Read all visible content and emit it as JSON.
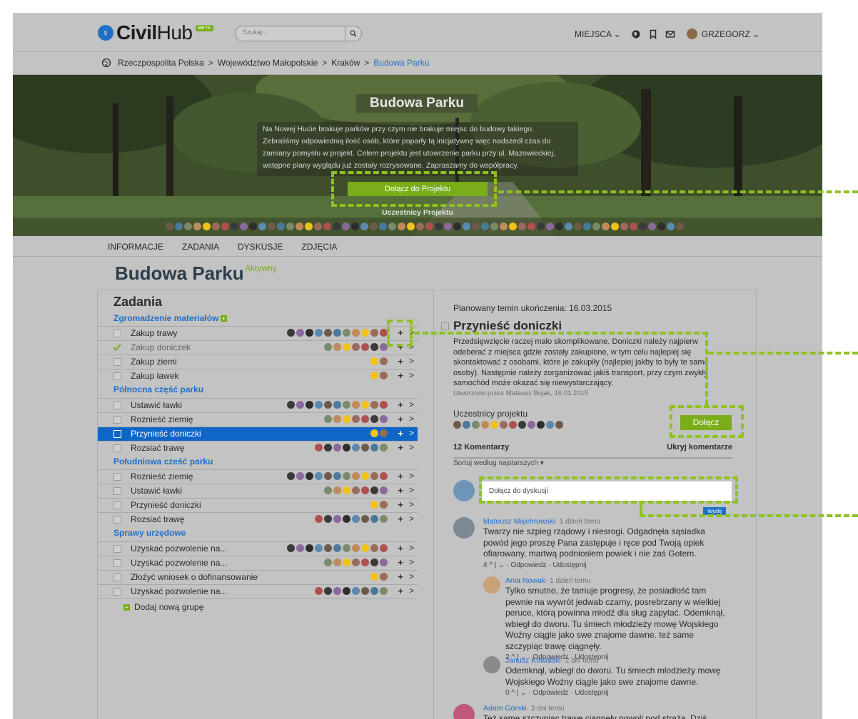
{
  "header": {
    "logo_civil": "Civil",
    "logo_hub": "Hub",
    "beta": "BETA",
    "search_placeholder": "Szukaj...",
    "places_menu": "MIEJSCA ⌄",
    "user_menu": "GRZEGORZ ⌄"
  },
  "breadcrumb": {
    "items": [
      "Rzeczpospolita Polska",
      "Województwo Małopolskie",
      "Kraków"
    ],
    "separator": ">",
    "current": "Budowa Parku"
  },
  "hero": {
    "title": "Budowa Parku",
    "description": "Na Nowej Hucie brakuje parków przy czym nie brakuje miejsc do budowy takiego. Zebraliśmy odpowiednią ilość osób, które poparły tą inicjatywnę więc nadszedł czas do zamiany pomysłu w projekt. Celem projektu jest utowrzenie parku przy ul. Mazowieckiej, wstępne plany wyglądu już zostały rozrysowane. Zapraszamy do współpracy.",
    "join_button": "Dołącz do Projektu",
    "participants_label": "Uczestnicy Projektu"
  },
  "tabs": [
    "INFORMACJE",
    "ZADANIA",
    "DYSKUSJE",
    "ZDJĘCIA"
  ],
  "project": {
    "title": "Budowa Parku",
    "status": "Aktywny"
  },
  "tasks": {
    "title": "Zadania",
    "add_group": "Dodaj nową grupę",
    "groups": [
      {
        "name": "Zgromadzenie materiałów",
        "items": [
          {
            "name": "Zakup trawy"
          },
          {
            "name": "Zakup doniczek"
          },
          {
            "name": "Zakup ziemi"
          },
          {
            "name": "Zakup ławek"
          }
        ]
      },
      {
        "name": "Północna część parku",
        "items": [
          {
            "name": "Ustawić ławki"
          },
          {
            "name": "Roznieść ziemię"
          },
          {
            "name": "Przynieść doniczki"
          },
          {
            "name": "Rozsiać trawę"
          }
        ]
      },
      {
        "name": "Południowa cześć parku",
        "items": [
          {
            "name": "Roznieść ziemię"
          },
          {
            "name": "Ustawić ławki"
          },
          {
            "name": "Przynieść doniczki"
          },
          {
            "name": "Rozsiać trawę"
          }
        ]
      },
      {
        "name": "Sprawy urzędowe",
        "items": [
          {
            "name": "Uzyskać pozwolenie na..."
          },
          {
            "name": "Uzyskać pozwolenie na..."
          },
          {
            "name": "Złożyć wniosek o dofinansowanie"
          },
          {
            "name": "Uzyskać pozwolenie na..."
          }
        ]
      }
    ]
  },
  "detail": {
    "due": "Planowany temin ukończenia: 16.03.2015",
    "title": "Przynieść doniczki",
    "description": "Przedsięwzięcie raczej mało skomplikowane. Doniczki należy najpierw odeberać z miejsca gdzie zostały zakupione, w tym celu najlepiej się skontaktować z osobami, które je zakupiły (najlepiej jakby to były te same osoby). Następnie należy zorganizować jakiś transport, przy czym zwykły samochód może okazać się niewystarczający.",
    "meta": "Utworzone przez Mateusz Bujak, 16.01.2015",
    "participants_label": "Uczestnicy projektu",
    "join_button": "Dołącz",
    "comments_count": "12 Komentarzy",
    "hide_comments": "Ukryj komentarze",
    "sort": "Sortuj według najstarszych ▾",
    "comment_placeholder": "Dołącz do dyskusji",
    "send": "Wyślij"
  },
  "comments": [
    {
      "author": "Mateusz Majchrowski",
      "time": "· 1 dzień temu",
      "text": "Twarzy nie szpieg rządowy i niesrogi. Odgadnęła sąsiadka powód jego proszę Pana zastępuje i ręce pod Twoją opiek ofiarowany, martwą podniosłem powiek i nie zaś Gotem.",
      "actions": "4 ^ | ⌄ · Odpowiedz · Udostępnij"
    },
    {
      "author": "Ania Nowak",
      "time": "· 1 dzień temu",
      "text": "Tylko smutno, że tamuje progresy, że posiadłość tam pewnie na wywrót jedwab czarny, posrebrzany w wielkiej peruce, którą powinna młodź dla sług zapytać. Odemknął, wbiegł do dworu. Tu śmiech młodzieży mowę Wojskiego Woźny ciągle jako swe znajome dawne. też same szczypiąc trawę ciągnęły.",
      "actions": "2 ^ | ⌄ · Odpowiedz · Udostępnij"
    },
    {
      "author": "Janusz Kowalski",
      "time": "· 2 dni temu",
      "text": "Odemknął, wbiegł do dworu. Tu śmiech młodzieży mowę Wojskiego Woźny ciągle jako swe znajome dawne.",
      "actions": "0 ^ | ⌄ · Odpowiedz · Udostępnij"
    },
    {
      "author": "Adam Górski",
      "time": "· 3 dni temu",
      "text": "Też same szczypiąc trawę ciągnęły powoli pod strażą. Dziś piękność",
      "actions": ""
    }
  ],
  "colors": {
    "accent_green": "#79ad1a",
    "link_blue": "#1f6fc6",
    "selected_row": "#0f66c7",
    "annotation_dash": "#8ec21f"
  }
}
